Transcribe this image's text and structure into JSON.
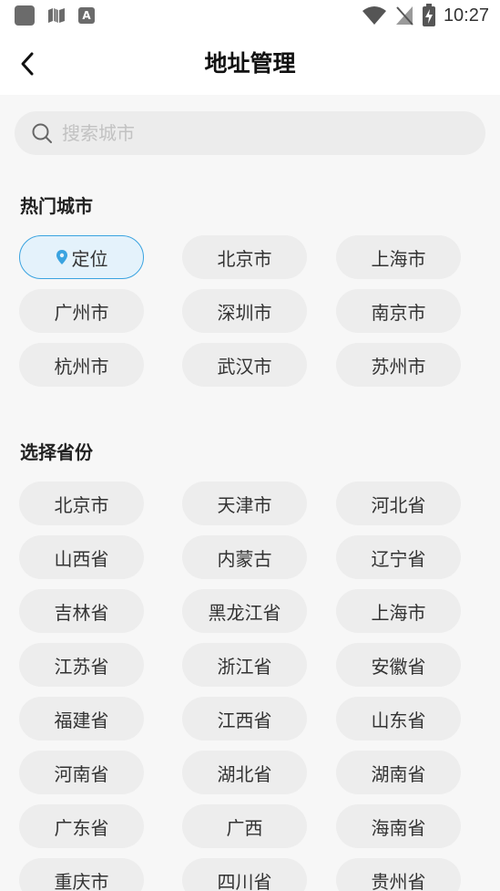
{
  "status_bar": {
    "time": "10:27",
    "app3_letter": "A"
  },
  "header": {
    "title": "地址管理"
  },
  "search": {
    "placeholder": "搜索城市"
  },
  "hot_cities": {
    "title": "热门城市",
    "locate_label": "定位",
    "items": [
      "北京市",
      "上海市",
      "广州市",
      "深圳市",
      "南京市",
      "杭州市",
      "武汉市",
      "苏州市"
    ]
  },
  "provinces": {
    "title": "选择省份",
    "items": [
      "北京市",
      "天津市",
      "河北省",
      "山西省",
      "内蒙古",
      "辽宁省",
      "吉林省",
      "黑龙江省",
      "上海市",
      "江苏省",
      "浙江省",
      "安徽省",
      "福建省",
      "江西省",
      "山东省",
      "河南省",
      "湖北省",
      "湖南省",
      "广东省",
      "广西",
      "海南省",
      "重庆市",
      "四川省",
      "贵州省"
    ]
  },
  "colors": {
    "accent": "#3aa3e0",
    "chip_bg": "#ededed",
    "locate_bg": "#e4f2fb"
  }
}
